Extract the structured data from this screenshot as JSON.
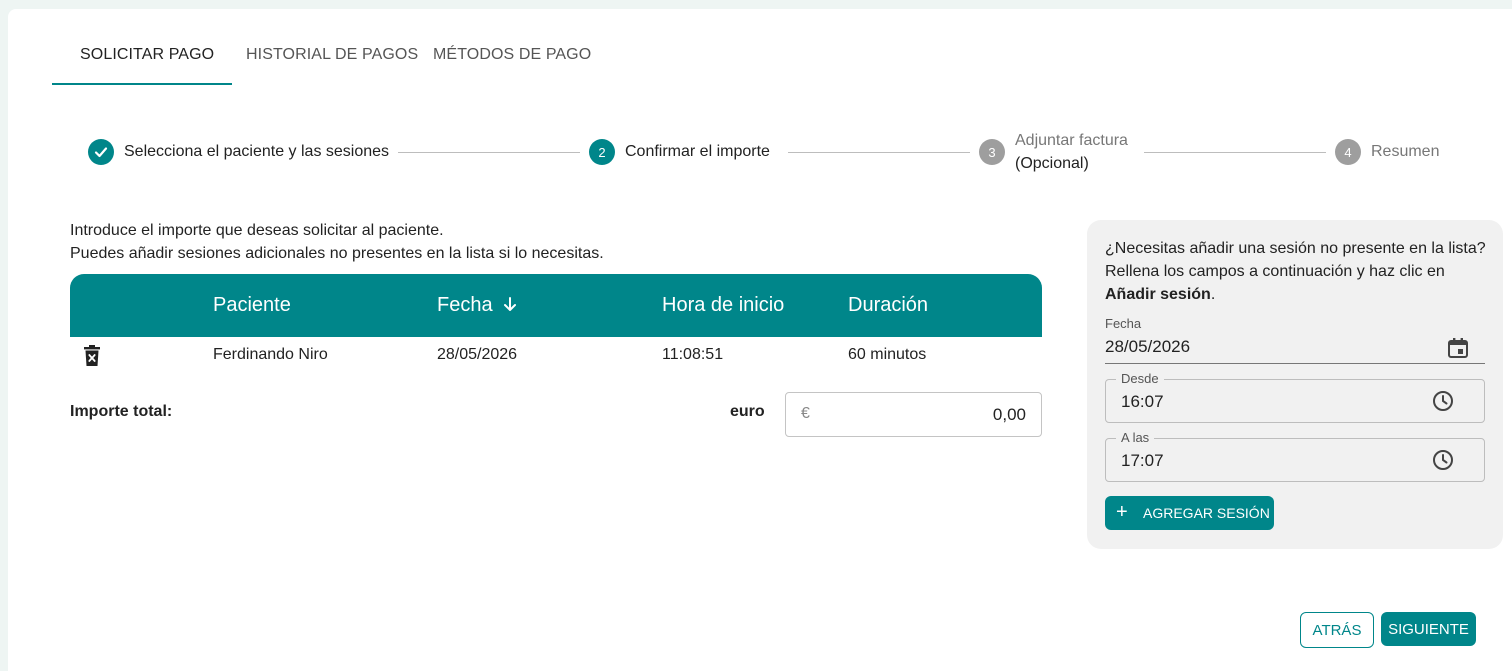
{
  "tabs": [
    {
      "label": "SOLICITAR PAGO",
      "active": true
    },
    {
      "label": "HISTORIAL DE PAGOS",
      "active": false
    },
    {
      "label": "MÉTODOS DE PAGO",
      "active": false
    }
  ],
  "stepper": {
    "steps": [
      {
        "number": "1",
        "label": "Selecciona el paciente y las sesiones",
        "state": "done"
      },
      {
        "number": "2",
        "label": "Confirmar el importe",
        "state": "current"
      },
      {
        "number": "3",
        "label": "Adjuntar factura",
        "sublabel": "(Opcional)",
        "state": "todo"
      },
      {
        "number": "4",
        "label": "Resumen",
        "state": "todo"
      }
    ]
  },
  "intro": {
    "line1": "Introduce el importe que deseas solicitar al paciente.",
    "line2": "Puedes añadir sesiones adicionales no presentes en la lista si lo necesitas."
  },
  "table": {
    "headers": {
      "patient": "Paciente",
      "date": "Fecha",
      "start": "Hora de inicio",
      "duration": "Duración"
    },
    "sort_icon": "arrow-down-icon",
    "rows": [
      {
        "patient": "Ferdinando Niro",
        "date": "28/05/2026",
        "start": "11:08:51",
        "duration": "60 minutos"
      }
    ]
  },
  "total": {
    "label": "Importe total:",
    "currency_label": "euro",
    "currency_symbol": "€",
    "amount": "0,00"
  },
  "side_panel": {
    "text_pre": "¿Necesitas añadir una sesión no presente en la lista? Rellena los campos a continuación y haz clic en ",
    "text_bold": "Añadir sesión",
    "text_post": ".",
    "date_label": "Fecha",
    "date_value": "28/05/2026",
    "from_label": "Desde",
    "from_value": "16:07",
    "to_label": "A las",
    "to_value": "17:07",
    "add_button": "AGREGAR SESIÓN"
  },
  "footer": {
    "back_label": "ATRÁS",
    "next_label": "SIGUIENTE"
  },
  "colors": {
    "accent": "#00868a",
    "muted_step": "#9e9e9e",
    "panel_bg": "#f1f1f1"
  }
}
